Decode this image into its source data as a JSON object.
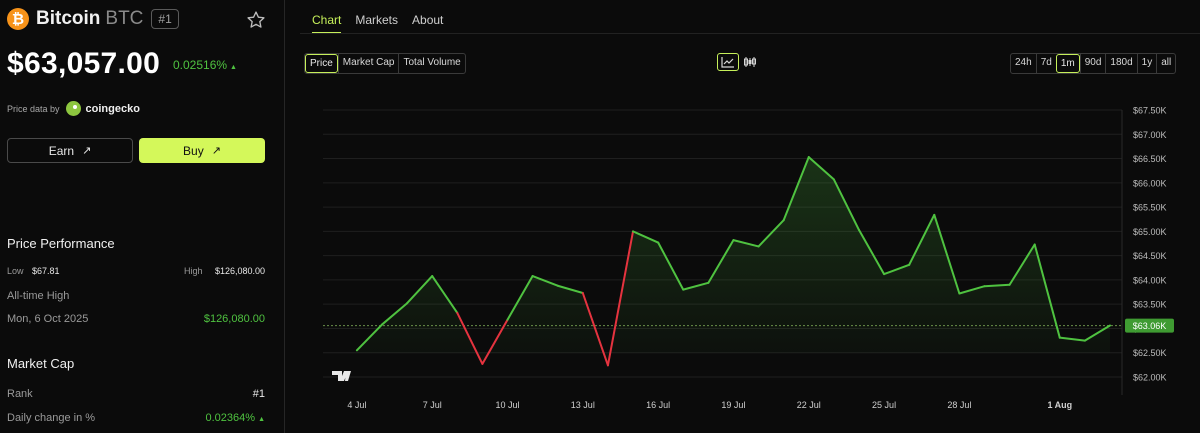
{
  "coin": {
    "logo_glyph": "₿",
    "name": "Bitcoin",
    "symbol": "BTC",
    "rank_badge": "#1",
    "price": "$63,057.00",
    "change": "0.02516%",
    "change_arrow": "▲",
    "price_data_label": "Price data by",
    "price_data_source": "coingecko"
  },
  "actions": {
    "earn_label": "Earn",
    "buy_label": "Buy",
    "arrow": "↗"
  },
  "performance": {
    "title": "Price Performance",
    "low_label": "Low",
    "low_value": "$67.81",
    "high_label": "High",
    "high_value": "$126,080.00",
    "ath_label": "All-time High",
    "ath_date": "Mon, 6 Oct 2025",
    "ath_value": "$126,080.00"
  },
  "market_cap": {
    "title": "Market Cap",
    "rank_label": "Rank",
    "rank_value": "#1",
    "daily_change_label": "Daily change in %",
    "daily_change_value": "0.02364%",
    "daily_change_arrow": "▲"
  },
  "tabs": [
    {
      "label": "Chart",
      "active": true
    },
    {
      "label": "Markets",
      "active": false
    },
    {
      "label": "About",
      "active": false
    }
  ],
  "metrics": [
    {
      "label": "Price",
      "active": true
    },
    {
      "label": "Market Cap",
      "active": false
    },
    {
      "label": "Total Volume",
      "active": false
    }
  ],
  "views": [
    {
      "icon": "line-chart-icon",
      "active": true
    },
    {
      "icon": "candlestick-icon",
      "active": false
    }
  ],
  "ranges": [
    {
      "label": "24h",
      "active": false
    },
    {
      "label": "7d",
      "active": false
    },
    {
      "label": "1m",
      "active": true
    },
    {
      "label": "90d",
      "active": false
    },
    {
      "label": "180d",
      "active": false
    },
    {
      "label": "1y",
      "active": false
    },
    {
      "label": "all",
      "active": false
    }
  ],
  "colors": {
    "up": "#4fc240",
    "down": "#e5333f",
    "accent": "#c6f05a",
    "button": "#d4f85a"
  },
  "chart_data": {
    "type": "line",
    "x_tick_labels": [
      "4 Jul",
      "7 Jul",
      "10 Jul",
      "13 Jul",
      "16 Jul",
      "19 Jul",
      "22 Jul",
      "25 Jul",
      "28 Jul",
      "1 Aug"
    ],
    "y_tick_labels": [
      "$67.50K",
      "$67.00K",
      "$66.50K",
      "$66.00K",
      "$65.50K",
      "$65.00K",
      "$64.50K",
      "$64.00K",
      "$63.50K",
      "$63.00K",
      "$62.50K",
      "$62.00K"
    ],
    "ylim": [
      62000,
      67500
    ],
    "x_domain": [
      "3 Jul",
      "3 Aug"
    ],
    "current_value": 63057,
    "current_label": "$63.06K",
    "grid": true,
    "points": [
      {
        "x": "4 Jul",
        "y": 62550
      },
      {
        "x": "5 Jul",
        "y": 63080
      },
      {
        "x": "6 Jul",
        "y": 63520
      },
      {
        "x": "7 Jul",
        "y": 64080
      },
      {
        "x": "8 Jul",
        "y": 63320
      },
      {
        "x": "9 Jul",
        "y": 62270
      },
      {
        "x": "10 Jul",
        "y": 63180
      },
      {
        "x": "11 Jul",
        "y": 64080
      },
      {
        "x": "12 Jul",
        "y": 63880
      },
      {
        "x": "13 Jul",
        "y": 63730
      },
      {
        "x": "14 Jul",
        "y": 62240
      },
      {
        "x": "15 Jul",
        "y": 65000
      },
      {
        "x": "16 Jul",
        "y": 64770
      },
      {
        "x": "17 Jul",
        "y": 63800
      },
      {
        "x": "18 Jul",
        "y": 63940
      },
      {
        "x": "19 Jul",
        "y": 64820
      },
      {
        "x": "20 Jul",
        "y": 64690
      },
      {
        "x": "21 Jul",
        "y": 65230
      },
      {
        "x": "22 Jul",
        "y": 66530
      },
      {
        "x": "23 Jul",
        "y": 66070
      },
      {
        "x": "24 Jul",
        "y": 65030
      },
      {
        "x": "25 Jul",
        "y": 64120
      },
      {
        "x": "26 Jul",
        "y": 64310
      },
      {
        "x": "27 Jul",
        "y": 65340
      },
      {
        "x": "28 Jul",
        "y": 63720
      },
      {
        "x": "29 Jul",
        "y": 63870
      },
      {
        "x": "30 Jul",
        "y": 63900
      },
      {
        "x": "31 Jul",
        "y": 64730
      },
      {
        "x": "1 Aug",
        "y": 62810
      },
      {
        "x": "2 Aug",
        "y": 62750
      },
      {
        "x": "3 Aug",
        "y": 63060
      }
    ]
  }
}
